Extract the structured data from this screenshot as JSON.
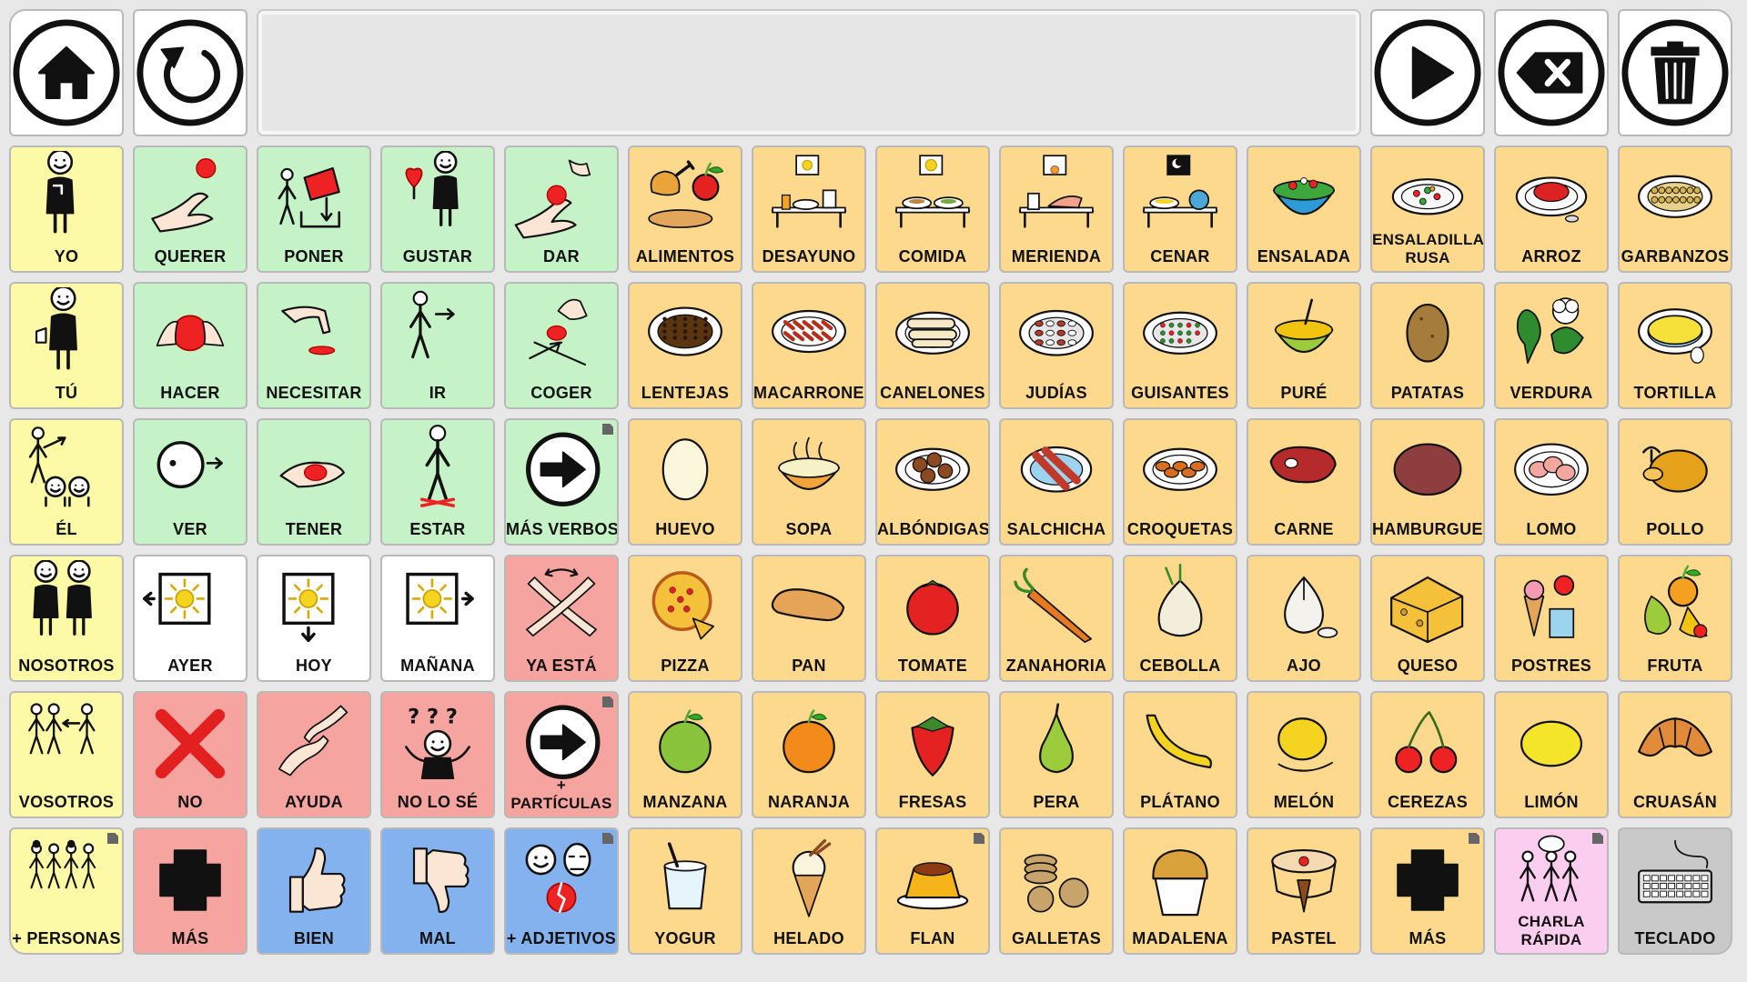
{
  "colors": {
    "white": "#ffffff",
    "yellow": "#fdfaa7",
    "green": "#c6f2c8",
    "orange": "#fdd98e",
    "red": "#f6a4a0",
    "blue": "#84b2ee",
    "pink": "#fbcdee",
    "gray": "#c9c9c9",
    "ctrl": "#ffffff"
  },
  "controls": {
    "home": {
      "icon": "home-icon"
    },
    "undo": {
      "icon": "undo-icon"
    },
    "sentence": {
      "text": ""
    },
    "speak": {
      "icon": "play-icon"
    },
    "backspace": {
      "icon": "backspace-icon"
    },
    "clear": {
      "icon": "trash-icon"
    }
  },
  "cells": [
    {
      "label": "YO",
      "color": "yellow",
      "icon": "person-me-icon",
      "corner": false
    },
    {
      "label": "QUERER",
      "color": "green",
      "icon": "hand-want-icon",
      "corner": false
    },
    {
      "label": "PONER",
      "color": "green",
      "icon": "put-icon",
      "corner": false
    },
    {
      "label": "GUSTAR",
      "color": "green",
      "icon": "like-heart-icon",
      "corner": false
    },
    {
      "label": "DAR",
      "color": "green",
      "icon": "give-icon",
      "corner": false
    },
    {
      "label": "ALIMENTOS",
      "color": "orange",
      "icon": "food-icon",
      "corner": false
    },
    {
      "label": "DESAYUNO",
      "color": "orange",
      "icon": "breakfast-icon",
      "corner": false
    },
    {
      "label": "COMIDA",
      "color": "orange",
      "icon": "lunch-icon",
      "corner": false
    },
    {
      "label": "MERIENDA",
      "color": "orange",
      "icon": "snack-icon",
      "corner": false
    },
    {
      "label": "CENAR",
      "color": "orange",
      "icon": "dinner-icon",
      "corner": false
    },
    {
      "label": "ENSALADA",
      "color": "orange",
      "icon": "salad-icon",
      "corner": false
    },
    {
      "label": "ENSALADILLA RUSA",
      "color": "orange",
      "icon": "russian-salad-icon",
      "corner": false
    },
    {
      "label": "ARROZ",
      "color": "orange",
      "icon": "rice-icon",
      "corner": false
    },
    {
      "label": "GARBANZOS",
      "color": "orange",
      "icon": "chickpeas-icon",
      "corner": false
    },
    {
      "label": "TÚ",
      "color": "yellow",
      "icon": "person-you-icon",
      "corner": false
    },
    {
      "label": "HACER",
      "color": "green",
      "icon": "hands-make-icon",
      "corner": false
    },
    {
      "label": "NECESITAR",
      "color": "green",
      "icon": "need-icon",
      "corner": false
    },
    {
      "label": "IR",
      "color": "green",
      "icon": "walk-icon",
      "corner": false
    },
    {
      "label": "COGER",
      "color": "green",
      "icon": "take-icon",
      "corner": false
    },
    {
      "label": "LENTEJAS",
      "color": "orange",
      "icon": "lentils-icon",
      "corner": false
    },
    {
      "label": "MACARRONES",
      "color": "orange",
      "icon": "macaroni-icon",
      "corner": false
    },
    {
      "label": "CANELONES",
      "color": "orange",
      "icon": "cannelloni-icon",
      "corner": false
    },
    {
      "label": "JUDÍAS",
      "color": "orange",
      "icon": "beans-icon",
      "corner": false
    },
    {
      "label": "GUISANTES",
      "color": "orange",
      "icon": "peas-icon",
      "corner": false
    },
    {
      "label": "PURÉ",
      "color": "orange",
      "icon": "puree-icon",
      "corner": false
    },
    {
      "label": "PATATAS",
      "color": "orange",
      "icon": "potato-icon",
      "corner": false
    },
    {
      "label": "VERDURA",
      "color": "orange",
      "icon": "vegetables-icon",
      "corner": false
    },
    {
      "label": "TORTILLA",
      "color": "orange",
      "icon": "omelette-icon",
      "corner": false
    },
    {
      "label": "ÉL",
      "color": "yellow",
      "icon": "person-he-icon",
      "corner": false
    },
    {
      "label": "VER",
      "color": "green",
      "icon": "see-icon",
      "corner": false
    },
    {
      "label": "TENER",
      "color": "green",
      "icon": "have-icon",
      "corner": false
    },
    {
      "label": "ESTAR",
      "color": "green",
      "icon": "stand-icon",
      "corner": false
    },
    {
      "label": "MÁS VERBOS",
      "color": "green",
      "icon": "arrow-right-circle-icon",
      "corner": true
    },
    {
      "label": "HUEVO",
      "color": "orange",
      "icon": "egg-icon",
      "corner": false
    },
    {
      "label": "SOPA",
      "color": "orange",
      "icon": "soup-icon",
      "corner": false
    },
    {
      "label": "ALBÓNDIGAS",
      "color": "orange",
      "icon": "meatballs-icon",
      "corner": false
    },
    {
      "label": "SALCHICHA",
      "color": "orange",
      "icon": "sausage-icon",
      "corner": false
    },
    {
      "label": "CROQUETAS",
      "color": "orange",
      "icon": "croquettes-icon",
      "corner": false
    },
    {
      "label": "CARNE",
      "color": "orange",
      "icon": "meat-icon",
      "corner": false
    },
    {
      "label": "HAMBURGUESA",
      "color": "orange",
      "icon": "burger-patty-icon",
      "corner": false
    },
    {
      "label": "LOMO",
      "color": "orange",
      "icon": "loin-icon",
      "corner": false
    },
    {
      "label": "POLLO",
      "color": "orange",
      "icon": "chicken-icon",
      "corner": false
    },
    {
      "label": "NOSOTROS",
      "color": "yellow",
      "icon": "people-we-icon",
      "corner": false
    },
    {
      "label": "AYER",
      "color": "white",
      "icon": "sun-left-icon",
      "corner": false
    },
    {
      "label": "HOY",
      "color": "white",
      "icon": "sun-down-icon",
      "corner": false
    },
    {
      "label": "MAÑANA",
      "color": "white",
      "icon": "sun-right-icon",
      "corner": false
    },
    {
      "label": "YA ESTÁ",
      "color": "red",
      "icon": "crossed-arms-icon",
      "corner": false
    },
    {
      "label": "PIZZA",
      "color": "orange",
      "icon": "pizza-icon",
      "corner": false
    },
    {
      "label": "PAN",
      "color": "orange",
      "icon": "bread-icon",
      "corner": false
    },
    {
      "label": "TOMATE",
      "color": "orange",
      "icon": "tomato-icon",
      "corner": false
    },
    {
      "label": "ZANAHORIA",
      "color": "orange",
      "icon": "carrot-icon",
      "corner": false
    },
    {
      "label": "CEBOLLA",
      "color": "orange",
      "icon": "onion-icon",
      "corner": false
    },
    {
      "label": "AJO",
      "color": "orange",
      "icon": "garlic-icon",
      "corner": false
    },
    {
      "label": "QUESO",
      "color": "orange",
      "icon": "cheese-icon",
      "corner": false
    },
    {
      "label": "POSTRES",
      "color": "orange",
      "icon": "desserts-icon",
      "corner": false
    },
    {
      "label": "FRUTA",
      "color": "orange",
      "icon": "fruit-icon",
      "corner": false
    },
    {
      "label": "VOSOTROS",
      "color": "yellow",
      "icon": "people-you-plural-icon",
      "corner": false
    },
    {
      "label": "NO",
      "color": "red",
      "icon": "red-x-icon",
      "corner": false
    },
    {
      "label": "AYUDA",
      "color": "red",
      "icon": "help-hands-icon",
      "corner": false
    },
    {
      "label": "NO LO SÉ",
      "color": "red",
      "icon": "question-person-icon",
      "corner": false
    },
    {
      "label": "+ PARTÍCULAS",
      "color": "red",
      "icon": "arrow-right-circle-icon",
      "corner": true
    },
    {
      "label": "MANZANA",
      "color": "orange",
      "icon": "apple-icon",
      "corner": false
    },
    {
      "label": "NARANJA",
      "color": "orange",
      "icon": "orange-icon",
      "corner": false
    },
    {
      "label": "FRESAS",
      "color": "orange",
      "icon": "strawberry-icon",
      "corner": false
    },
    {
      "label": "PERA",
      "color": "orange",
      "icon": "pear-icon",
      "corner": false
    },
    {
      "label": "PLÁTANO",
      "color": "orange",
      "icon": "banana-icon",
      "corner": false
    },
    {
      "label": "MELÓN",
      "color": "orange",
      "icon": "melon-icon",
      "corner": false
    },
    {
      "label": "CEREZAS",
      "color": "orange",
      "icon": "cherries-icon",
      "corner": false
    },
    {
      "label": "LIMÓN",
      "color": "orange",
      "icon": "lemon-icon",
      "corner": false
    },
    {
      "label": "CRUASÁN",
      "color": "orange",
      "icon": "croissant-icon",
      "corner": false
    },
    {
      "label": "+ PERSONAS",
      "color": "yellow",
      "icon": "group-people-icon",
      "corner": true
    },
    {
      "label": "MÁS",
      "color": "red",
      "icon": "plus-icon",
      "corner": false
    },
    {
      "label": "BIEN",
      "color": "blue",
      "icon": "thumbs-up-icon",
      "corner": false
    },
    {
      "label": "MAL",
      "color": "blue",
      "icon": "thumbs-down-icon",
      "corner": false
    },
    {
      "label": "+ ADJETIVOS",
      "color": "blue",
      "icon": "faces-icon",
      "corner": true
    },
    {
      "label": "YOGUR",
      "color": "orange",
      "icon": "yogurt-icon",
      "corner": false
    },
    {
      "label": "HELADO",
      "color": "orange",
      "icon": "ice-cream-icon",
      "corner": false
    },
    {
      "label": "FLAN",
      "color": "orange",
      "icon": "flan-icon",
      "corner": true
    },
    {
      "label": "GALLETAS",
      "color": "orange",
      "icon": "cookies-icon",
      "corner": false
    },
    {
      "label": "MADALENA",
      "color": "orange",
      "icon": "muffin-icon",
      "corner": false
    },
    {
      "label": "PASTEL",
      "color": "orange",
      "icon": "cake-icon",
      "corner": false
    },
    {
      "label": "MÁS",
      "color": "orange",
      "icon": "plus-icon",
      "corner": true
    },
    {
      "label": "CHARLA RÁPIDA",
      "color": "pink",
      "icon": "quick-chat-icon",
      "corner": true
    },
    {
      "label": "TECLADO",
      "color": "gray",
      "icon": "keyboard-icon",
      "corner": false
    }
  ]
}
